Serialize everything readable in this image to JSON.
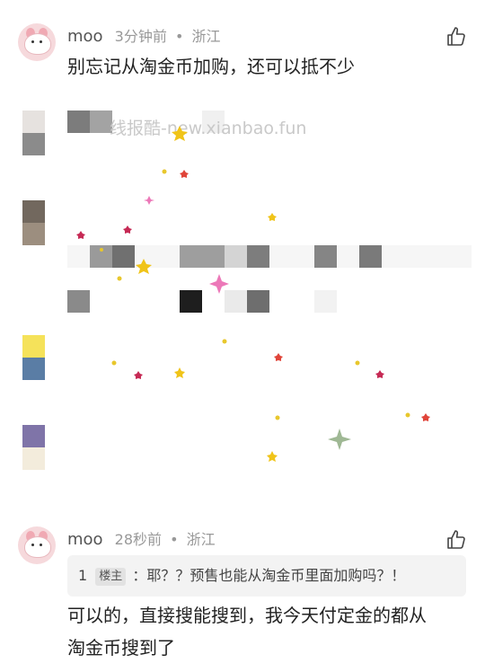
{
  "comments": [
    {
      "user": "moo",
      "time": "3分钟前",
      "separator": "•",
      "location": "浙江",
      "text": "别忘记从淘金币加购，还可以抵不少"
    },
    {
      "user": "moo",
      "time": "28秒前",
      "separator": "•",
      "location": "浙江",
      "quote": {
        "floor": "1",
        "tag": "楼主",
        "text": "：耶？？预售也能从淘金币里面加购吗？！"
      },
      "text_line1": "可以的，直接搜能搜到，我今天付定金的都从",
      "text_line2": "淘金币搜到了"
    }
  ],
  "watermark": "线报酷-new.xianbao.fun",
  "icons": {
    "like": "thumbs-up-icon"
  }
}
